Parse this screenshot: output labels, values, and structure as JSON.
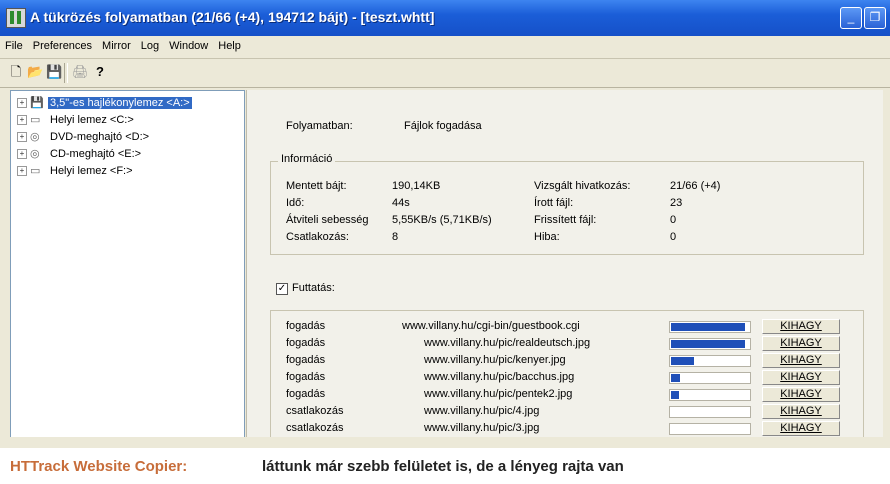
{
  "window": {
    "title": "A tükrözés folyamatban (21/66 (+4), 194712 bájt) - [teszt.whtt]"
  },
  "menu": [
    "File",
    "Preferences",
    "Mirror",
    "Log",
    "Window",
    "Help"
  ],
  "toolbar": {
    "icons": [
      "new-icon",
      "open-folder-icon",
      "save-icon",
      "print-icon",
      "help-icon"
    ],
    "glyphs": [
      "🗋",
      "📂",
      "💾",
      "🖨",
      "?"
    ]
  },
  "tree": [
    {
      "label": "3,5\"-es hajlékonylemez <A:>",
      "icon": "floppy-drive-icon",
      "selected": true
    },
    {
      "label": "Helyi lemez <C:>",
      "icon": "hard-disk-icon",
      "selected": false
    },
    {
      "label": "DVD-meghajtó <D:>",
      "icon": "dvd-drive-icon",
      "selected": false
    },
    {
      "label": "CD-meghajtó <E:>",
      "icon": "cd-drive-icon",
      "selected": false
    },
    {
      "label": "Helyi lemez <F:>",
      "icon": "hard-disk-icon",
      "selected": false
    }
  ],
  "progress": {
    "status_label": "Folyamatban:",
    "status_value": "Fájlok fogadása",
    "info_title": "Információ",
    "stats_left": [
      {
        "label": "Mentett bájt:",
        "value": "190,14KB"
      },
      {
        "label": "Idő:",
        "value": "44s"
      },
      {
        "label": "Átviteli sebesség",
        "value": "5,55KB/s (5,71KB/s)"
      },
      {
        "label": "Csatlakozás:",
        "value": "8"
      }
    ],
    "stats_right": [
      {
        "label": "Vizsgált hivatkozás:",
        "value": "21/66 (+4)"
      },
      {
        "label": "Írott fájl:",
        "value": "23"
      },
      {
        "label": "Frissített fájl:",
        "value": "0"
      },
      {
        "label": "Hiba:",
        "value": "0"
      }
    ],
    "run_checkbox": {
      "label": "Futtatás:",
      "checked": true
    },
    "transfers": [
      {
        "status": "fogadás",
        "url": "www.villany.hu/cgi-bin/guestbook.cgi",
        "progress": 0.95,
        "action": "KIHAGY"
      },
      {
        "status": "fogadás",
        "url": "www.villany.hu/pic/realdeutsch.jpg",
        "progress": 0.95,
        "action": "KIHAGY"
      },
      {
        "status": "fogadás",
        "url": "www.villany.hu/pic/kenyer.jpg",
        "progress": 0.3,
        "action": "KIHAGY"
      },
      {
        "status": "fogadás",
        "url": "www.villany.hu/pic/bacchus.jpg",
        "progress": 0.12,
        "action": "KIHAGY"
      },
      {
        "status": "fogadás",
        "url": "www.villany.hu/pic/pentek2.jpg",
        "progress": 0.1,
        "action": "KIHAGY"
      },
      {
        "status": "csatlakozás",
        "url": "www.villany.hu/pic/4.jpg",
        "progress": 0,
        "action": "KIHAGY"
      },
      {
        "status": "csatlakozás",
        "url": "www.villany.hu/pic/3.jpg",
        "progress": 0,
        "action": "KIHAGY"
      }
    ]
  },
  "caption": {
    "brand": "HTTrack Website Copier:",
    "text": "láttunk már szebb felületet is, de a lényeg rajta van"
  },
  "colors": {
    "titlebar": "#1b5ed8",
    "progress_fill": "#1f4fb8",
    "caption_brand": "#c76d3a",
    "selection": "#316ac5"
  }
}
